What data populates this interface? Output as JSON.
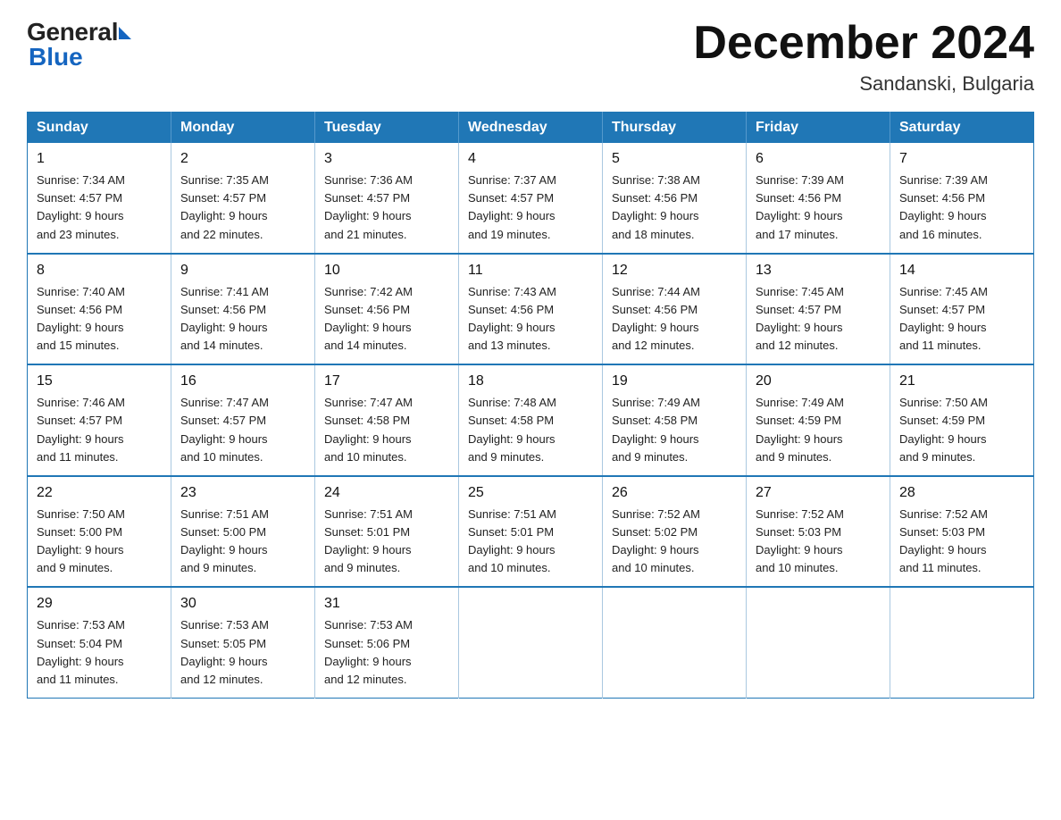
{
  "header": {
    "logo_general": "General",
    "logo_blue": "Blue",
    "month_title": "December 2024",
    "location": "Sandanski, Bulgaria"
  },
  "days_of_week": [
    "Sunday",
    "Monday",
    "Tuesday",
    "Wednesday",
    "Thursday",
    "Friday",
    "Saturday"
  ],
  "weeks": [
    [
      {
        "day": "1",
        "sunrise": "7:34 AM",
        "sunset": "4:57 PM",
        "daylight": "9 hours and 23 minutes."
      },
      {
        "day": "2",
        "sunrise": "7:35 AM",
        "sunset": "4:57 PM",
        "daylight": "9 hours and 22 minutes."
      },
      {
        "day": "3",
        "sunrise": "7:36 AM",
        "sunset": "4:57 PM",
        "daylight": "9 hours and 21 minutes."
      },
      {
        "day": "4",
        "sunrise": "7:37 AM",
        "sunset": "4:57 PM",
        "daylight": "9 hours and 19 minutes."
      },
      {
        "day": "5",
        "sunrise": "7:38 AM",
        "sunset": "4:56 PM",
        "daylight": "9 hours and 18 minutes."
      },
      {
        "day": "6",
        "sunrise": "7:39 AM",
        "sunset": "4:56 PM",
        "daylight": "9 hours and 17 minutes."
      },
      {
        "day": "7",
        "sunrise": "7:39 AM",
        "sunset": "4:56 PM",
        "daylight": "9 hours and 16 minutes."
      }
    ],
    [
      {
        "day": "8",
        "sunrise": "7:40 AM",
        "sunset": "4:56 PM",
        "daylight": "9 hours and 15 minutes."
      },
      {
        "day": "9",
        "sunrise": "7:41 AM",
        "sunset": "4:56 PM",
        "daylight": "9 hours and 14 minutes."
      },
      {
        "day": "10",
        "sunrise": "7:42 AM",
        "sunset": "4:56 PM",
        "daylight": "9 hours and 14 minutes."
      },
      {
        "day": "11",
        "sunrise": "7:43 AM",
        "sunset": "4:56 PM",
        "daylight": "9 hours and 13 minutes."
      },
      {
        "day": "12",
        "sunrise": "7:44 AM",
        "sunset": "4:56 PM",
        "daylight": "9 hours and 12 minutes."
      },
      {
        "day": "13",
        "sunrise": "7:45 AM",
        "sunset": "4:57 PM",
        "daylight": "9 hours and 12 minutes."
      },
      {
        "day": "14",
        "sunrise": "7:45 AM",
        "sunset": "4:57 PM",
        "daylight": "9 hours and 11 minutes."
      }
    ],
    [
      {
        "day": "15",
        "sunrise": "7:46 AM",
        "sunset": "4:57 PM",
        "daylight": "9 hours and 11 minutes."
      },
      {
        "day": "16",
        "sunrise": "7:47 AM",
        "sunset": "4:57 PM",
        "daylight": "9 hours and 10 minutes."
      },
      {
        "day": "17",
        "sunrise": "7:47 AM",
        "sunset": "4:58 PM",
        "daylight": "9 hours and 10 minutes."
      },
      {
        "day": "18",
        "sunrise": "7:48 AM",
        "sunset": "4:58 PM",
        "daylight": "9 hours and 9 minutes."
      },
      {
        "day": "19",
        "sunrise": "7:49 AM",
        "sunset": "4:58 PM",
        "daylight": "9 hours and 9 minutes."
      },
      {
        "day": "20",
        "sunrise": "7:49 AM",
        "sunset": "4:59 PM",
        "daylight": "9 hours and 9 minutes."
      },
      {
        "day": "21",
        "sunrise": "7:50 AM",
        "sunset": "4:59 PM",
        "daylight": "9 hours and 9 minutes."
      }
    ],
    [
      {
        "day": "22",
        "sunrise": "7:50 AM",
        "sunset": "5:00 PM",
        "daylight": "9 hours and 9 minutes."
      },
      {
        "day": "23",
        "sunrise": "7:51 AM",
        "sunset": "5:00 PM",
        "daylight": "9 hours and 9 minutes."
      },
      {
        "day": "24",
        "sunrise": "7:51 AM",
        "sunset": "5:01 PM",
        "daylight": "9 hours and 9 minutes."
      },
      {
        "day": "25",
        "sunrise": "7:51 AM",
        "sunset": "5:01 PM",
        "daylight": "9 hours and 10 minutes."
      },
      {
        "day": "26",
        "sunrise": "7:52 AM",
        "sunset": "5:02 PM",
        "daylight": "9 hours and 10 minutes."
      },
      {
        "day": "27",
        "sunrise": "7:52 AM",
        "sunset": "5:03 PM",
        "daylight": "9 hours and 10 minutes."
      },
      {
        "day": "28",
        "sunrise": "7:52 AM",
        "sunset": "5:03 PM",
        "daylight": "9 hours and 11 minutes."
      }
    ],
    [
      {
        "day": "29",
        "sunrise": "7:53 AM",
        "sunset": "5:04 PM",
        "daylight": "9 hours and 11 minutes."
      },
      {
        "day": "30",
        "sunrise": "7:53 AM",
        "sunset": "5:05 PM",
        "daylight": "9 hours and 12 minutes."
      },
      {
        "day": "31",
        "sunrise": "7:53 AM",
        "sunset": "5:06 PM",
        "daylight": "9 hours and 12 minutes."
      },
      null,
      null,
      null,
      null
    ]
  ],
  "labels": {
    "sunrise": "Sunrise:",
    "sunset": "Sunset:",
    "daylight": "Daylight:"
  }
}
